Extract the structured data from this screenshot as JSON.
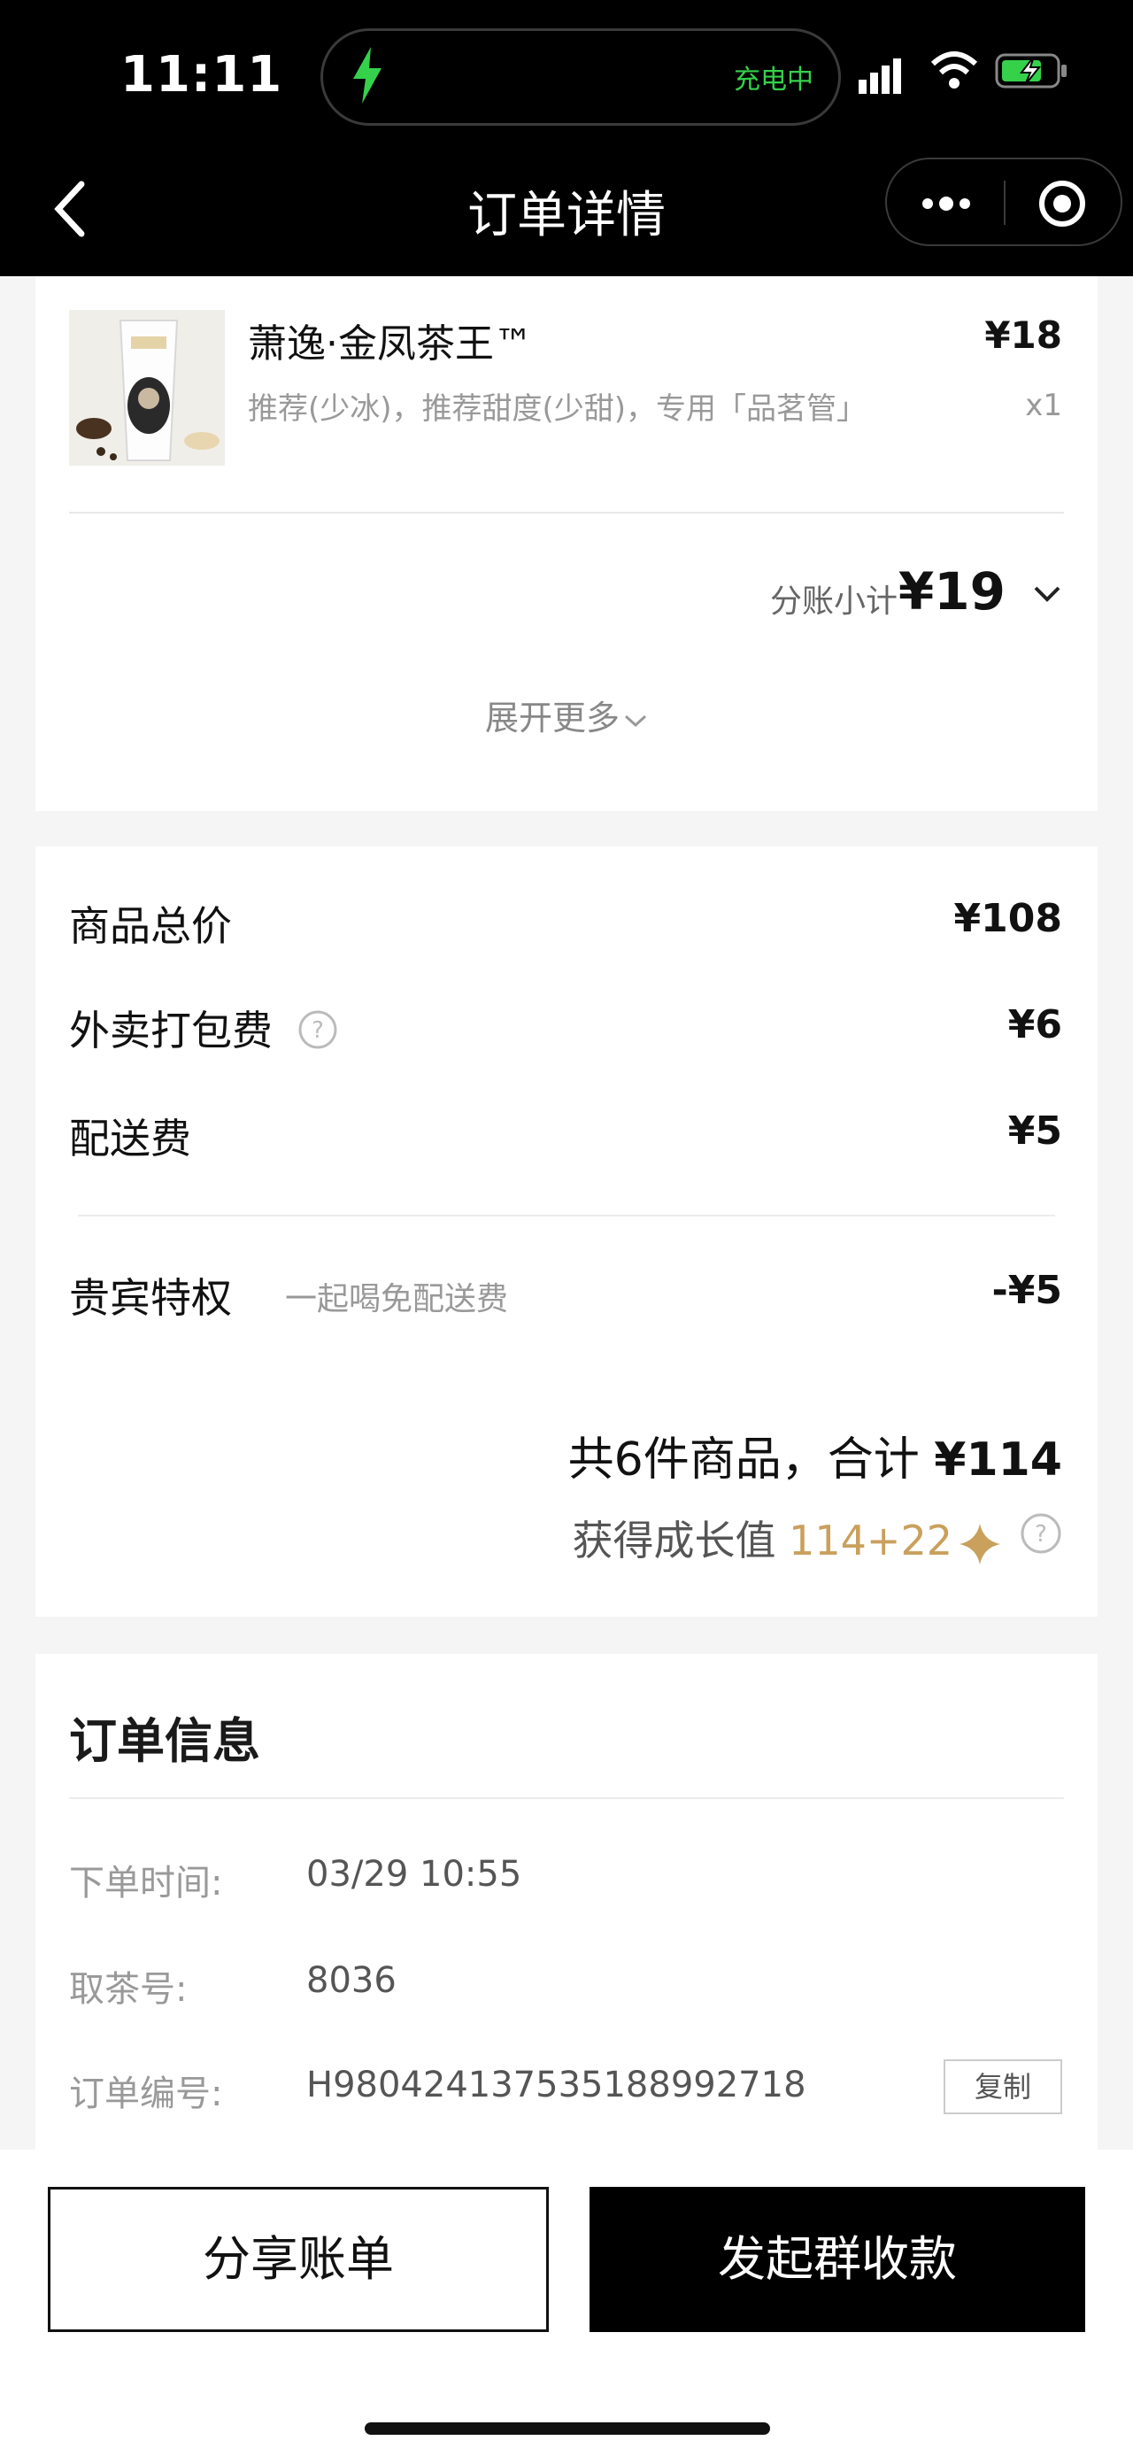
{
  "status_bar": {
    "time": "11:11",
    "charging_text": "充电中",
    "accent_green": "#35d14b"
  },
  "nav": {
    "title": "订单详情",
    "back_icon": "chevron-left-icon",
    "more_icon": "more-dots-icon",
    "close_icon": "target-icon"
  },
  "order_item": {
    "name": "萧逸·金凤茶王™",
    "price": "¥18",
    "options": "推荐(少冰)，推荐甜度(少甜)，专用「品茗管」",
    "quantity": "x1"
  },
  "split_subtotal": {
    "label": "分账小计",
    "value": "¥19"
  },
  "expand_more": "展开更多",
  "fees": {
    "goods_total_label": "商品总价",
    "goods_total_value": "¥108",
    "packing_fee_label": "外卖打包费",
    "packing_fee_value": "¥6",
    "delivery_fee_label": "配送费",
    "delivery_fee_value": "¥5",
    "vip_label": "贵宾特权",
    "vip_desc": "一起喝免配送费",
    "vip_value": "-¥5",
    "total_prefix": "共6件商品，合计",
    "total_value": "¥114",
    "growth_label": "获得成长值",
    "growth_value": "114+22",
    "growth_color": "#c9a05c"
  },
  "order_info": {
    "title": "订单信息",
    "order_time_label": "下单时间:",
    "order_time_value": "03/29 10:55",
    "pickup_label": "取茶号:",
    "pickup_value": "8036",
    "order_no_label": "订单编号:",
    "order_no_value": "H980424137535188992718",
    "copy_label": "复制"
  },
  "actions": {
    "share_label": "分享账单",
    "collect_label": "发起群收款"
  }
}
